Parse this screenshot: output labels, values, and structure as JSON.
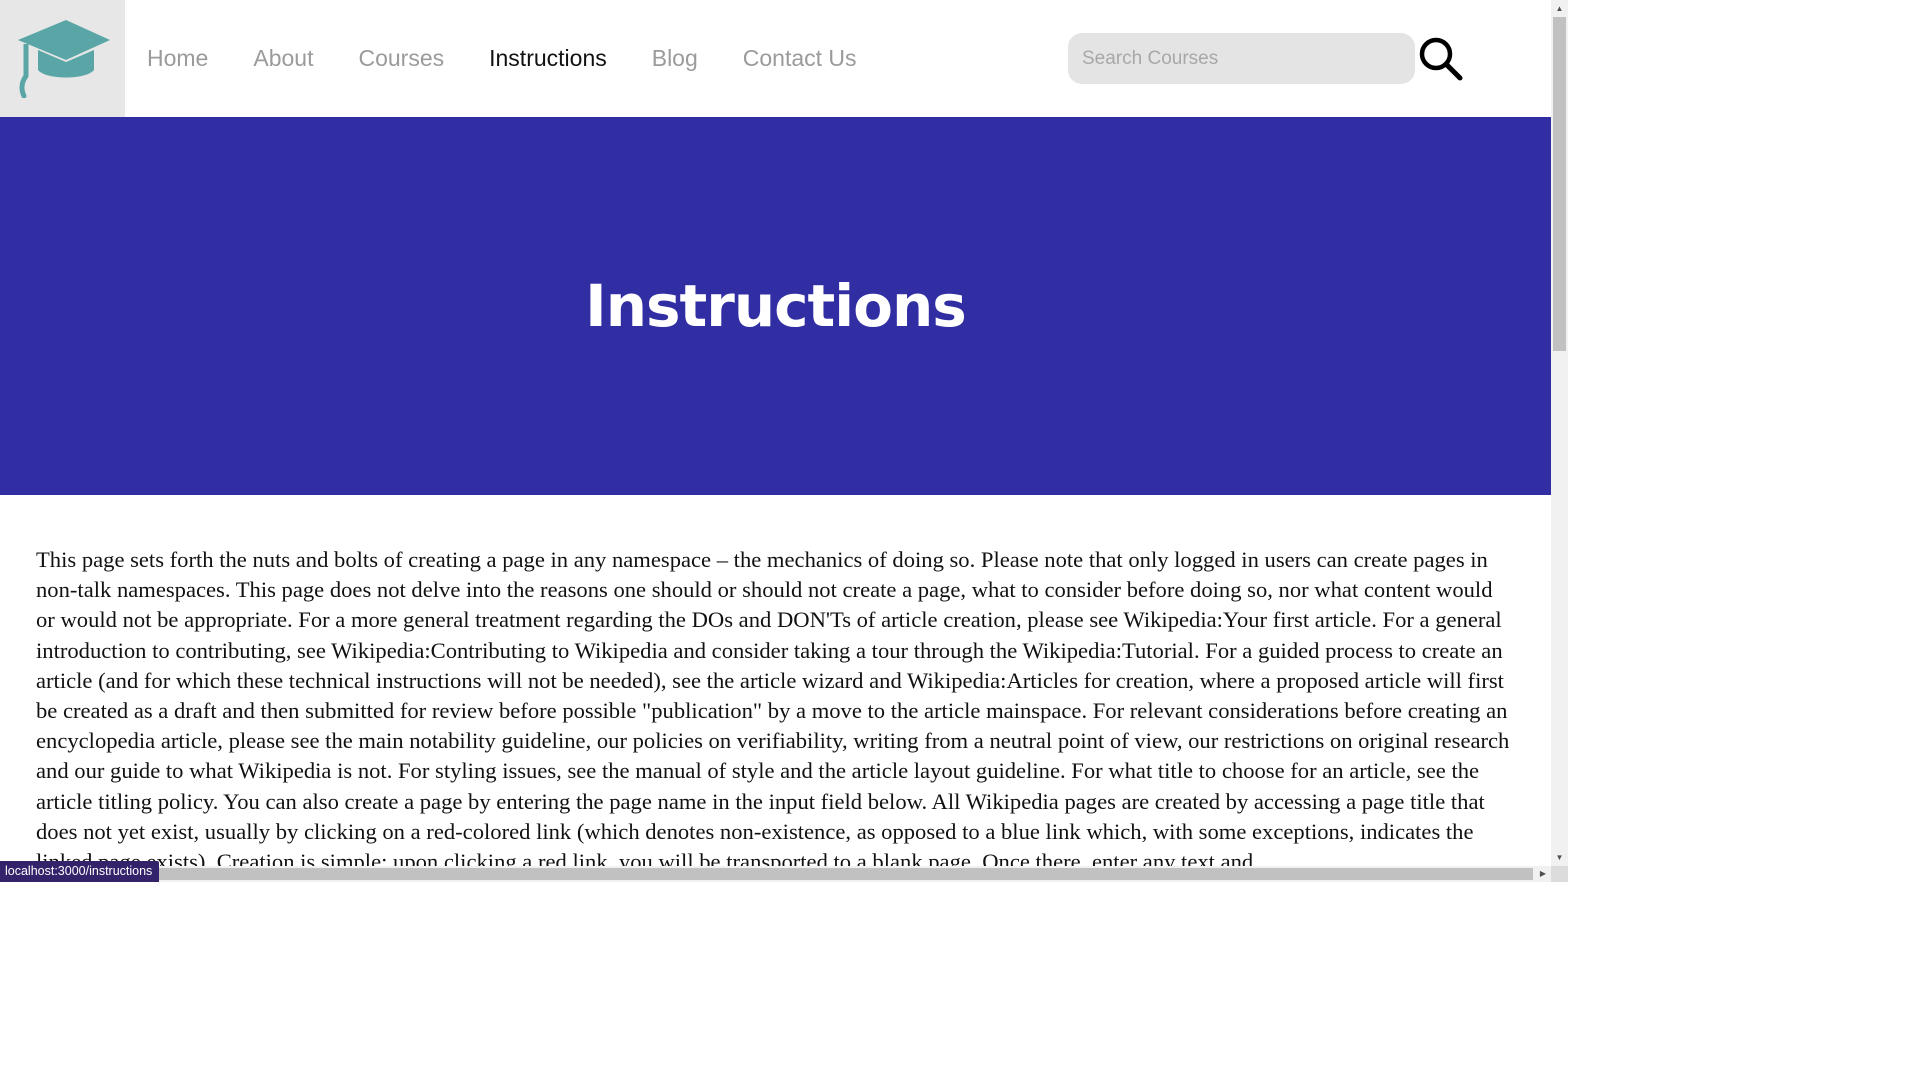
{
  "nav": {
    "items": [
      {
        "label": "Home"
      },
      {
        "label": "About"
      },
      {
        "label": "Courses"
      },
      {
        "label": "Instructions"
      },
      {
        "label": "Blog"
      },
      {
        "label": "Contact Us"
      }
    ],
    "active": "Instructions"
  },
  "search": {
    "placeholder": "Search Courses",
    "value": "",
    "icon": "search-icon"
  },
  "logo": {
    "icon": "graduation-cap-icon",
    "color": "#5aa6a6"
  },
  "hero": {
    "title": "Instructions",
    "background": "#302ea2"
  },
  "content": {
    "paragraph": "This page sets forth the nuts and bolts of creating a page in any namespace – the mechanics of doing so. Please note that only logged in users can create pages in non-talk namespaces. This page does not delve into the reasons one should or should not create a page, what to consider before doing so, nor what content would or would not be appropriate. For a more general treatment regarding the DOs and DON'Ts of article creation, please see Wikipedia:Your first article. For a general introduction to contributing, see Wikipedia:Contributing to Wikipedia and consider taking a tour through the Wikipedia:Tutorial. For a guided process to create an article (and for which these technical instructions will not be needed), see the article wizard and Wikipedia:Articles for creation, where a proposed article will first be created as a draft and then submitted for review before possible \"publication\" by a move to the article mainspace. For relevant considerations before creating an encyclopedia article, please see the main notability guideline, our policies on verifiability, writing from a neutral point of view, our restrictions on original research and our guide to what Wikipedia is not. For styling issues, see the manual of style and the article layout guideline. For what title to choose for an article, see the article titling policy. You can also create a page by entering the page name in the input field below. All Wikipedia pages are created by accessing a page title that does not yet exist, usually by clicking on a red-colored link (which denotes non-existence, as opposed to a blue link which, with some exceptions, indicates the linked page exists). Creation is simple: upon clicking a red link, you will be transported to a blank page. Once there, enter any text and"
  },
  "status_bar": {
    "url": "localhost:3000/instructions"
  }
}
